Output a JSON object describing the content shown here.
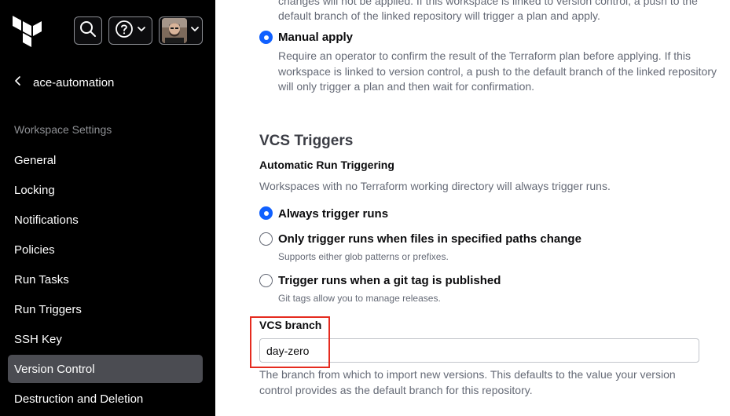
{
  "sidebar": {
    "workspace_name": "ace-automation",
    "section_label": "Workspace Settings",
    "items": [
      {
        "label": "General",
        "active": false
      },
      {
        "label": "Locking",
        "active": false
      },
      {
        "label": "Notifications",
        "active": false
      },
      {
        "label": "Policies",
        "active": false
      },
      {
        "label": "Run Tasks",
        "active": false
      },
      {
        "label": "Run Triggers",
        "active": false
      },
      {
        "label": "SSH Key",
        "active": false
      },
      {
        "label": "Version Control",
        "active": true
      },
      {
        "label": "Destruction and Deletion",
        "active": false
      }
    ]
  },
  "apply_method": {
    "cut_off_text": "changes will not be applied. If this workspace is linked to version control, a push to the default branch of the linked repository will trigger a plan and apply.",
    "manual_apply": {
      "label": "Manual apply",
      "description": "Require an operator to confirm the result of the Terraform plan before applying. If this workspace is linked to version control, a push to the default branch of the linked repository will only trigger a plan and then wait for confirmation.",
      "selected": true
    }
  },
  "vcs_triggers": {
    "title": "VCS Triggers",
    "subtitle": "Automatic Run Triggering",
    "description": "Workspaces with no Terraform working directory will always trigger runs.",
    "options": [
      {
        "label": "Always trigger runs",
        "help": "",
        "selected": true
      },
      {
        "label": "Only trigger runs when files in specified paths change",
        "help": "Supports either glob patterns or prefixes.",
        "selected": false
      },
      {
        "label": "Trigger runs when a git tag is published",
        "help": "Git tags allow you to manage releases.",
        "selected": false
      }
    ]
  },
  "vcs_branch": {
    "label": "VCS branch",
    "value": "day-zero",
    "help": "The branch from which to import new versions. This defaults to the value your version control provides as the default branch for this repository."
  },
  "colors": {
    "sidebar_bg": "#000000",
    "active_item_bg": "#4b4c52",
    "radio_selected": "#1060ff",
    "highlight": "#e52b1f"
  },
  "icons": [
    "terraform-logo",
    "search-icon",
    "help-icon",
    "chevron-down-icon",
    "avatar",
    "chevron-left-icon"
  ]
}
